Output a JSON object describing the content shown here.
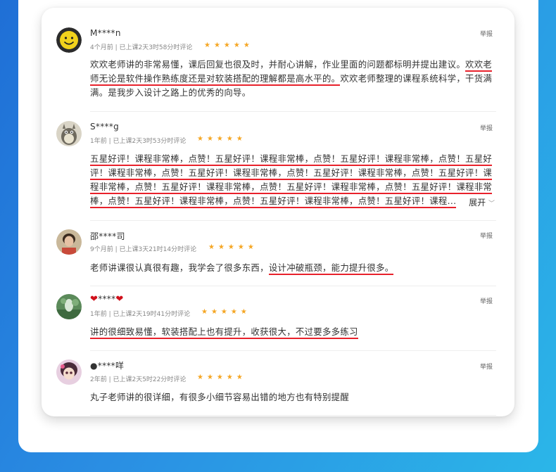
{
  "reviews": [
    {
      "name": "M****n",
      "meta": "4个月前 | 已上课2天3时58分时评论",
      "stars": "★★★★★",
      "report": "举报",
      "text_plain": "欢欢老师讲的非常易懂，课后回复也很及时，并耐心讲解，作业里面的问题都标明并提出建议。",
      "text_underlined": "欢欢老师无论是软件操作熟练度还是对软装搭配的理解都是高水平的。",
      "text_tail": "欢欢老师整理的课程系统科学，干货满满。是我步入设计之路上的优秀的向导。"
    },
    {
      "name": "S****g",
      "meta": "1年前 | 已上课2天3时53分时评论",
      "stars": "★★★★★",
      "report": "举报",
      "text_underlined": "五星好评！课程非常棒，点赞！五星好评！课程非常棒，点赞！五星好评！课程非常棒，点赞！五星好评！课程非常棒，点赞！五星好评！课程非常棒，点赞！五星好评！课程非常棒，点赞！五星好评！课程非常棒，点赞！五星好评！课程非常棒，点赞！五星好评！课程非常棒，点赞！五星好评！课程非常棒，点赞！五星好评！课程非常棒，点赞！五星好评！课程非常棒，点赞！五星好评！课程...",
      "expand_label": "展开",
      "expand_icon": "chevron-down-icon"
    },
    {
      "name": "邵****司",
      "meta": "9个月前 | 已上课3天21时14分时评论",
      "stars": "★★★★★",
      "report": "举报",
      "text_plain": "老师讲课很认真很有趣，我学会了很多东西，",
      "text_underlined": "设计冲破瓶颈，能力提升很多。"
    },
    {
      "name": "****",
      "name_icon": "heart-icon",
      "meta": "1年前 | 已上课2天19时41分时评论",
      "stars": "★★★★★",
      "report": "举报",
      "text_underlined": "讲的很细致易懂，软装搭配上也有提升，收获很大，不过要多多练习"
    },
    {
      "name": "●****咩",
      "meta": "2年前 | 已上课2天5时22分时评论",
      "stars": "★★★★★",
      "report": "举报",
      "text_plain": "丸子老师讲的很详细，有很多小细节容易出错的地方也有特别提醒"
    }
  ],
  "colors": {
    "underline": "#e8212b",
    "star": "#f5a623",
    "background_gradient_start": "#1f6fd6",
    "background_gradient_end": "#2bb6e8"
  }
}
